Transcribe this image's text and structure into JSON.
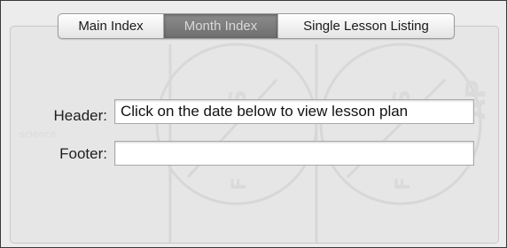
{
  "tabs": [
    {
      "label": "Main Index",
      "selected": false
    },
    {
      "label": "Month Index",
      "selected": true
    },
    {
      "label": "Single Lesson Listing",
      "selected": false
    }
  ],
  "form": {
    "header_label": "Header:",
    "header_value": "Click on the date below to view lesson plan",
    "footer_label": "Footer:",
    "footer_value": ""
  },
  "colors": {
    "window_bg": "#ececec",
    "selected_tab": "#7a7a7a",
    "border": "#3a3a3a"
  }
}
